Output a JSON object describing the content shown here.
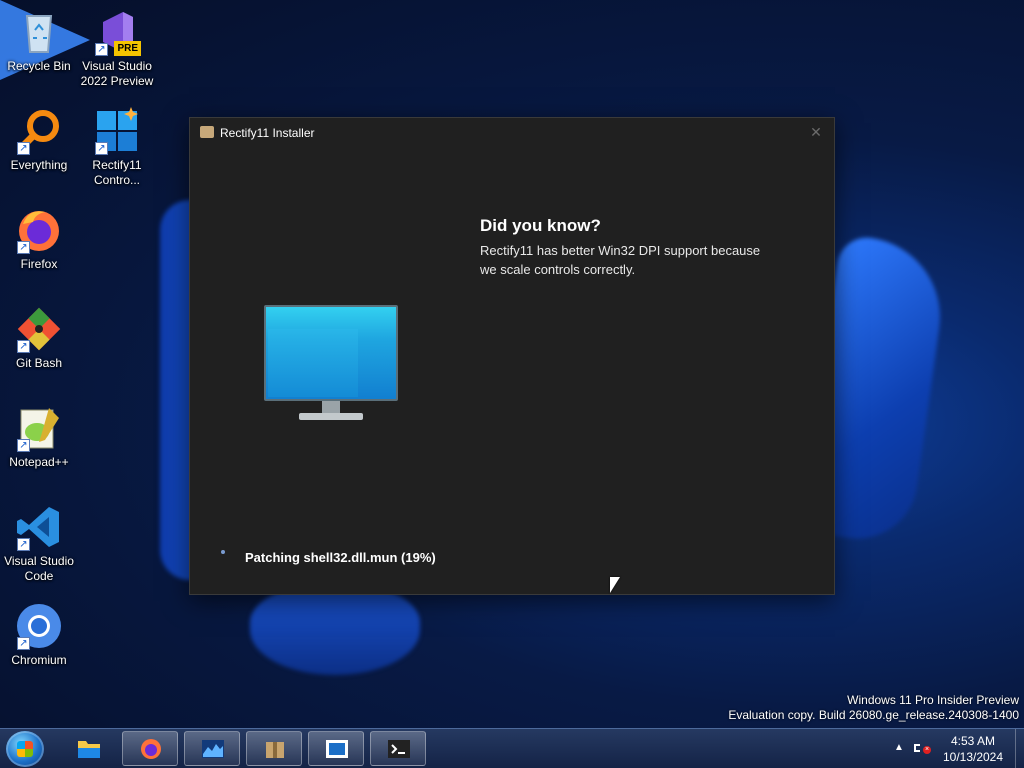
{
  "desktop": {
    "icons": [
      {
        "label": "Recycle Bin",
        "icon": "recycle-bin-icon"
      },
      {
        "label": "Visual Studio 2022 Preview",
        "icon": "visual-studio-icon",
        "badge": "PRE"
      },
      {
        "label": "Everything",
        "icon": "everything-search-icon"
      },
      {
        "label": "Rectify11 Contro...",
        "icon": "rectify11-control-icon"
      },
      {
        "label": "Firefox",
        "icon": "firefox-icon"
      },
      {
        "label": "Git Bash",
        "icon": "git-bash-icon"
      },
      {
        "label": "Notepad++",
        "icon": "notepad-plus-plus-icon"
      },
      {
        "label": "Visual Studio Code",
        "icon": "vscode-icon"
      },
      {
        "label": "Chromium",
        "icon": "chromium-icon"
      }
    ],
    "shortcut_glyph": "↗"
  },
  "installer": {
    "title": "Rectify11 Installer",
    "close_glyph": "✕",
    "tip_title": "Did you know?",
    "tip_body": "Rectify11 has better Win32 DPI support because we scale controls correctly.",
    "status": "Patching shell32.dll.mun (19%)",
    "progress_percent": 19
  },
  "watermark": {
    "line1": "Windows 11 Pro Insider Preview",
    "line2": "Evaluation copy. Build 26080.ge_release.240308-1400"
  },
  "taskbar": {
    "items": [
      {
        "name": "file-explorer",
        "icon": "folder-icon"
      },
      {
        "name": "firefox",
        "icon": "firefox-icon"
      },
      {
        "name": "task-manager",
        "icon": "performance-chart-icon"
      },
      {
        "name": "rectify11-installer",
        "icon": "package-icon"
      },
      {
        "name": "app-window",
        "icon": "window-icon"
      },
      {
        "name": "terminal",
        "icon": "terminal-icon"
      }
    ],
    "tray_arrow": "▲",
    "time": "4:53 AM",
    "date": "10/13/2024"
  },
  "colors": {
    "window_bg": "#202020",
    "taskbar": "#1e3260",
    "accent": "#1c6fc7"
  }
}
